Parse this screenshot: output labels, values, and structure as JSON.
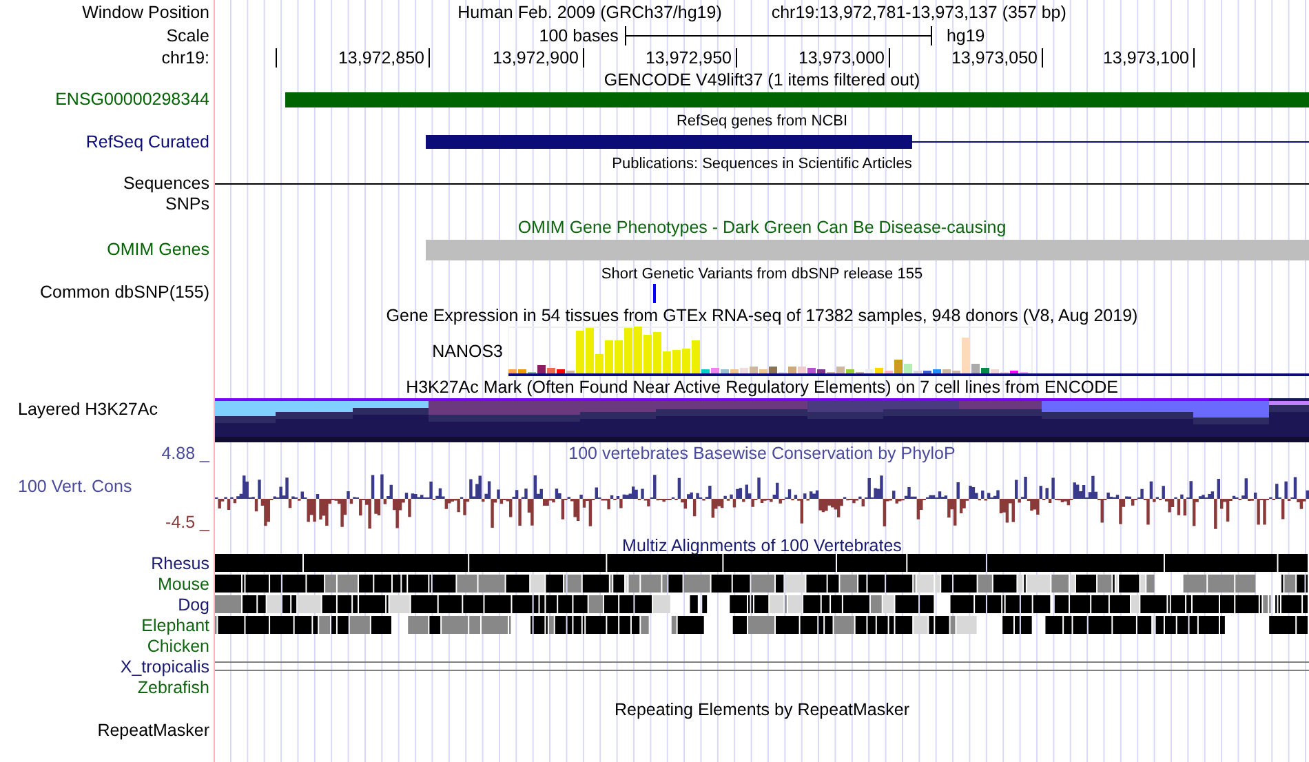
{
  "position": {
    "label": "Window Position",
    "assembly": "Human Feb. 2009 (GRCh37/hg19)",
    "range": "chr19:13,972,781-13,973,137 (357 bp)"
  },
  "scale": {
    "label": "Scale",
    "length": "100 bases",
    "assembly": "hg19"
  },
  "ruler": {
    "label": "chr19:",
    "ticks": [
      "13,972,850",
      "13,972,900",
      "13,972,950",
      "13,973,000",
      "13,973,050",
      "13,973,100"
    ]
  },
  "tracks": [
    {
      "kind": "gene",
      "title": "GENCODE V49lift37 (1 items filtered out)",
      "label": "ENSG00000298344",
      "color": "#006400"
    },
    {
      "kind": "transcript",
      "title": "RefSeq genes from NCBI",
      "label": "RefSeq Curated",
      "color": "#0c0c78"
    },
    {
      "kind": "publications",
      "title": "Publications: Sequences in Scientific Articles",
      "labels": [
        "Sequences",
        "SNPs"
      ]
    },
    {
      "kind": "omim",
      "title": "OMIM Gene Phenotypes - Dark Green Can Be Disease-causing",
      "label": "OMIM Genes",
      "color": "#006400"
    },
    {
      "kind": "snp",
      "title": "Short Genetic Variants from dbSNP release 155",
      "label": "Common dbSNP(155)"
    },
    {
      "kind": "expression",
      "title": "Gene Expression in 54 tissues from GTEx RNA-seq of 17382 samples, 948 donors (V8, Aug 2019)",
      "gene": "NANOS3"
    },
    {
      "kind": "layered",
      "title": "H3K27Ac Mark (Often Found Near Active Regulatory Elements) on 7 cell lines from ENCODE",
      "label": "Layered H3K27Ac"
    },
    {
      "kind": "wiggle",
      "title": "100 vertebrates Basewise Conservation by PhyloP",
      "label": "100 Vert. Cons",
      "color": "#4a4a9c",
      "max": "4.88 _",
      "min": "-4.5 _"
    },
    {
      "kind": "multiz",
      "title": "Multiz Alignments of 100 Vertebrates",
      "species": [
        {
          "name": "Rhesus",
          "kind": "blocks",
          "color": "#191970"
        },
        {
          "name": "Mouse",
          "kind": "blocks",
          "color": "#0f640f"
        },
        {
          "name": "Dog",
          "kind": "blocks",
          "color": "#191970"
        },
        {
          "name": "Elephant",
          "kind": "blocks",
          "color": "#0f640f"
        },
        {
          "name": "Chicken",
          "kind": "empty",
          "color": "#0f640f"
        },
        {
          "name": "X_tropicalis",
          "kind": "lines",
          "color": "#191970"
        },
        {
          "name": "Zebrafish",
          "kind": "empty",
          "color": "#0f640f"
        }
      ]
    },
    {
      "kind": "repeat",
      "title": "Repeating Elements by RepeatMasker",
      "label": "RepeatMasker"
    }
  ]
}
